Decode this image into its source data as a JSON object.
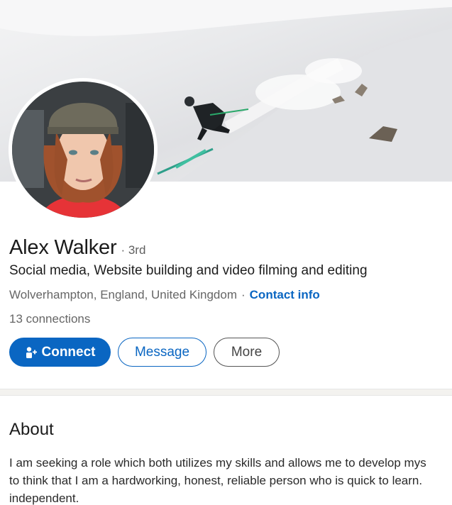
{
  "profile": {
    "name": "Alex Walker",
    "degree": "· 3rd",
    "headline": "Social media, Website building and video filming and editing",
    "location": "Wolverhampton, England, United Kingdom",
    "location_separator": "·",
    "contact_info": "Contact info",
    "connections": "13 connections"
  },
  "actions": {
    "connect_label": "Connect",
    "message_label": "Message",
    "more_label": "More"
  },
  "about": {
    "title": "About",
    "lines": [
      "I am seeking a role which both utilizes my skills and allows me to develop mys",
      "to think that I am a hardworking, honest, reliable person who is quick to learn.",
      "independent."
    ]
  },
  "colors": {
    "accent": "#0a66c2",
    "cover_snow": "#e9eaec"
  },
  "icons": {
    "connect": "person-add-icon"
  }
}
